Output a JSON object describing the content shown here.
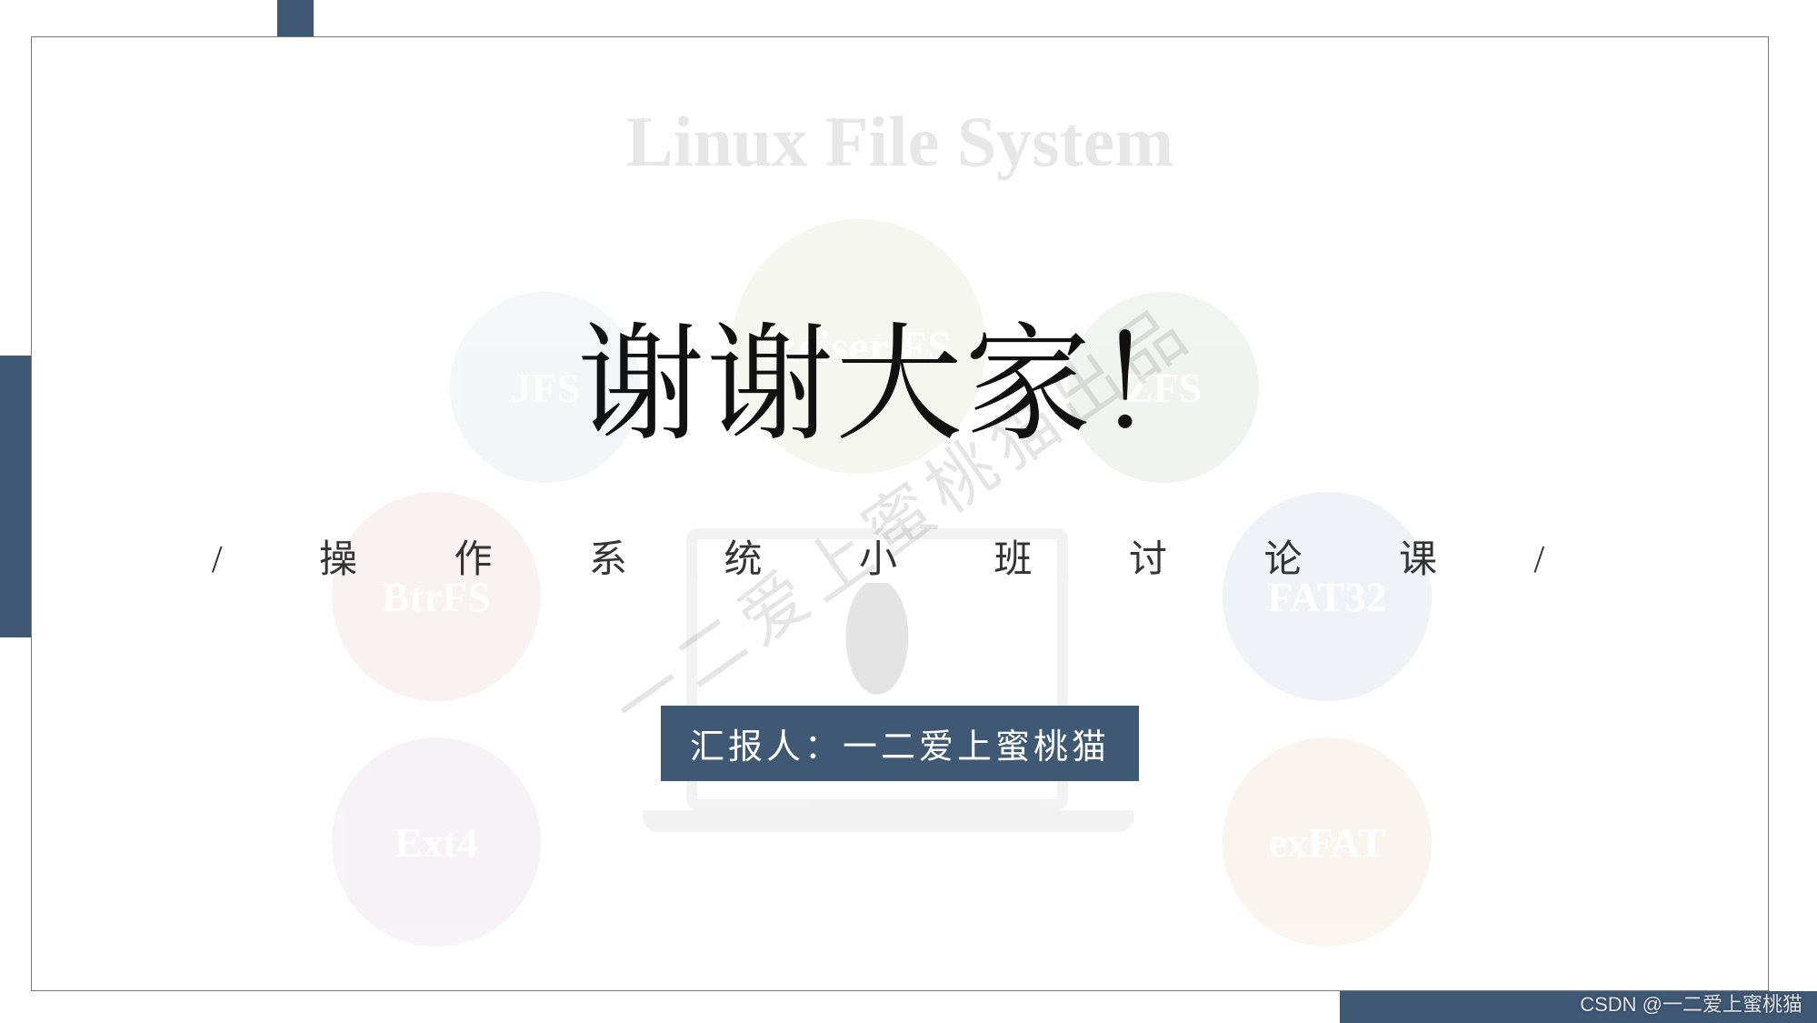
{
  "slide": {
    "main_title": "谢谢大家！",
    "subtitle": "/ 操 作 系 统 小 班 讨 论 课 /",
    "presenter_label": "汇报人：一二爱上蜜桃猫"
  },
  "background": {
    "title": "Linux File System",
    "circles": {
      "jfs": "JFS",
      "reiser": "Reiser FS",
      "zfs": "ZFS",
      "btrfs": "BtrFS",
      "fat32": "FAT32",
      "ext4": "Ext4",
      "exfat": "exFAT"
    }
  },
  "watermark": "一二爱上蜜桃猫出品",
  "footer_credit": "CSDN @一二爱上蜜桃猫"
}
